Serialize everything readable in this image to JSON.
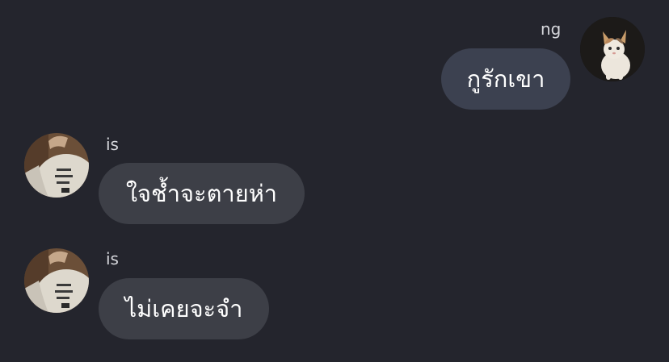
{
  "chat": {
    "messages": [
      {
        "sender": "ng",
        "text": "กูรักเขา",
        "direction": "outgoing",
        "avatar": "cat-photo-avatar"
      },
      {
        "sender": "is",
        "text": "ใจช้ำจะตายห่า",
        "direction": "incoming",
        "avatar": "person-white-shirt-avatar"
      },
      {
        "sender": "is",
        "text": "ไม่เคยจะจำ",
        "direction": "incoming",
        "avatar": "person-white-shirt-avatar"
      }
    ]
  },
  "colors": {
    "background": "#24252d",
    "outgoing_bubble": "#3c4150",
    "incoming_bubble": "#3d3f47",
    "message_text": "#ffffff",
    "sender_text": "#d6d7dc"
  }
}
